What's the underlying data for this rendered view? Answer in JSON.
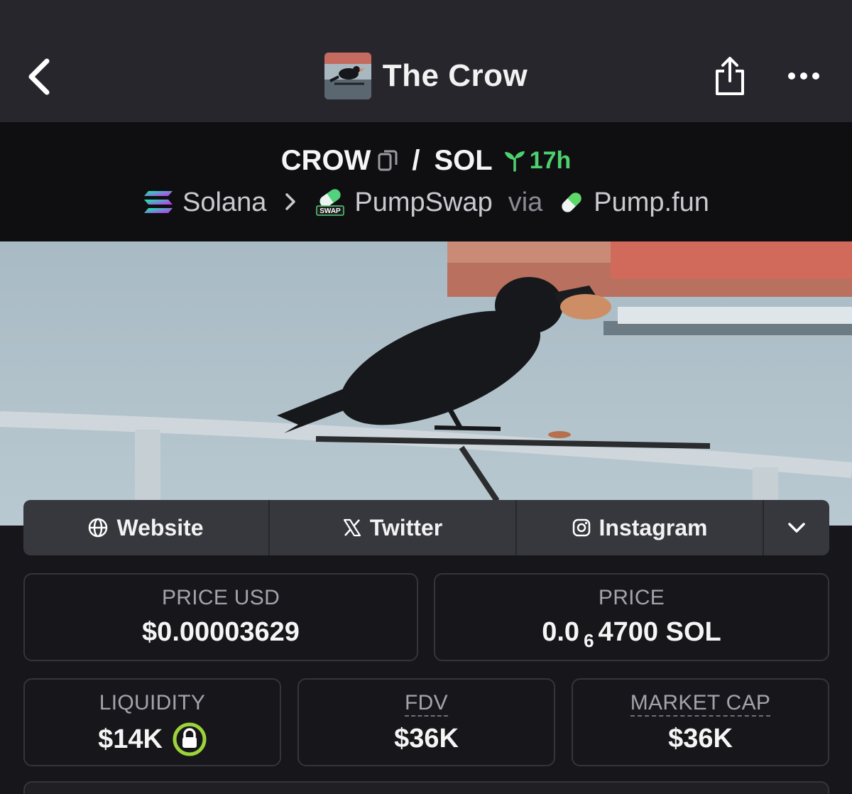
{
  "header": {
    "title": "The Crow"
  },
  "pair": {
    "base": "CROW",
    "separator": "/",
    "quote": "SOL",
    "age": "17h"
  },
  "route": {
    "chain": "Solana",
    "dex": "PumpSwap",
    "via_label": "via",
    "launchpad": "Pump.fun",
    "dex_badge": "SWAP"
  },
  "socials": {
    "website": "Website",
    "twitter": "Twitter",
    "instagram": "Instagram"
  },
  "stats": {
    "price_usd_label": "PRICE USD",
    "price_usd_value": "$0.00003629",
    "price_label": "PRICE",
    "price_prefix": "0.0",
    "price_subscript": "6",
    "price_suffix": "4700 SOL",
    "liquidity_label": "LIQUIDITY",
    "liquidity_value": "$14K",
    "fdv_label": "FDV",
    "fdv_value": "$36K",
    "mcap_label": "MARKET CAP",
    "mcap_value": "$36K"
  },
  "colors": {
    "accent_green": "#4ed16d",
    "lock_green": "#9bd43a",
    "background": "#17171b",
    "nav_bg": "#26262c"
  },
  "icons": {
    "back": "chevron-left-icon",
    "share": "share-icon",
    "more": "more-dots-icon",
    "copy": "copy-icon",
    "sprout": "sprout-icon",
    "globe": "globe-icon",
    "x": "x-logo-icon",
    "instagram": "instagram-icon",
    "expand": "chevron-down-icon",
    "lock": "lock-icon"
  }
}
